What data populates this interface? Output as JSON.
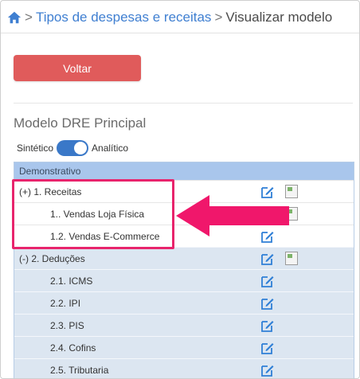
{
  "breadcrumb": {
    "home_icon": "home-icon",
    "items": [
      "Tipos de despesas e receitas",
      "Visualizar modelo"
    ],
    "separator": ">"
  },
  "actions": {
    "back_label": "Voltar"
  },
  "model": {
    "title": "Modelo DRE Principal",
    "toggle": {
      "left_label": "Sintético",
      "right_label": "Analítico",
      "state": "Analítico"
    }
  },
  "table": {
    "header": "Demonstrativo",
    "rows": [
      {
        "label": "(+) 1. Receitas",
        "style": "white"
      },
      {
        "label": "1.. Vendas Loja Física",
        "style": "white"
      },
      {
        "label": "1.2. Vendas E-Commerce",
        "style": "white"
      },
      {
        "label": "(-) 2. Deduções",
        "style": "blue"
      },
      {
        "label": "2.1. ICMS",
        "style": "blue"
      },
      {
        "label": "2.2. IPI",
        "style": "blue"
      },
      {
        "label": "2.3. PIS",
        "style": "blue"
      },
      {
        "label": "2.4. Cofins",
        "style": "blue"
      },
      {
        "label": "2.5. Tributaria",
        "style": "blue"
      }
    ]
  },
  "colors": {
    "accent": "#3a78c8",
    "back_button": "#e05b5b",
    "highlight": "#e8246c",
    "table_header": "#a9c6ec",
    "row_blue": "#dce6f1"
  }
}
